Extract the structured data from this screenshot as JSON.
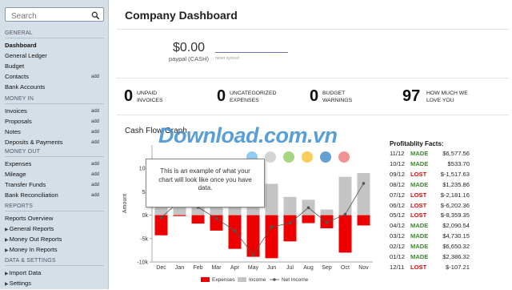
{
  "search": {
    "placeholder": "Search"
  },
  "sidebar": {
    "sections": [
      {
        "title": "General",
        "items": [
          {
            "label": "Dashboard",
            "active": true
          },
          {
            "label": "General Ledger"
          },
          {
            "label": "Budget"
          },
          {
            "label": "Contacts",
            "action": "add"
          },
          {
            "label": "Bank Accounts"
          }
        ]
      },
      {
        "title": "Money In",
        "items": [
          {
            "label": "Invoices",
            "action": "add"
          },
          {
            "label": "Proposals",
            "action": "add"
          },
          {
            "label": "Notes",
            "action": "add"
          },
          {
            "label": "Deposits & Payments",
            "action": "add"
          }
        ]
      },
      {
        "title": "Money Out",
        "items": [
          {
            "label": "Expenses",
            "action": "add"
          },
          {
            "label": "Mileage",
            "action": "add"
          },
          {
            "label": "Transfer Funds",
            "action": "add"
          },
          {
            "label": "Bank Reconciliation",
            "action": "add"
          }
        ]
      },
      {
        "title": "Reports",
        "items": [
          {
            "label": "Reports Overview"
          },
          {
            "label": "General Reports",
            "expandable": true
          },
          {
            "label": "Money Out Reports",
            "expandable": true
          },
          {
            "label": "Money In Reports",
            "expandable": true
          }
        ]
      },
      {
        "title": "Data & Settings",
        "items": [
          {
            "label": "Import Data",
            "expandable": true
          },
          {
            "label": "Settings",
            "expandable": true
          }
        ]
      }
    ]
  },
  "header": {
    "title": "Company Dashboard"
  },
  "balance": {
    "value": "$0.00",
    "label": "paypal (CASH)",
    "sync": "never synced"
  },
  "stats": [
    {
      "value": "0",
      "line1": "Unpaid",
      "line2": "Invoices"
    },
    {
      "value": "0",
      "line1": "Uncategorized",
      "line2": "Expenses"
    },
    {
      "value": "0",
      "line1": "Budget",
      "line2": "Warnings"
    },
    {
      "value": "97",
      "line1": "How much we",
      "line2": "love you"
    }
  ],
  "cashflow": {
    "title": "Cash Flow Graph",
    "watermark": "Download.com.vn",
    "tooltip": "This is an example of what your chart will look like once you have data.",
    "legend_colors": [
      "#7ec5ec",
      "#cccccc",
      "#9acd6a",
      "#f5c542",
      "#4a90c8",
      "#f08080"
    ]
  },
  "chart_data": {
    "type": "bar",
    "categories": [
      "Dec",
      "Jan",
      "Feb",
      "Mar",
      "Apr",
      "May",
      "Jun",
      "Jul",
      "Aug",
      "Sep",
      "Oct",
      "Nov"
    ],
    "ylabel": "Amount",
    "yticks": [
      "10k",
      "5k",
      "0k",
      "-5k",
      "-10k"
    ],
    "ylim": [
      -10000,
      15000
    ],
    "series": [
      {
        "name": "Expenses",
        "color": "#ee0000",
        "values": [
          -4300,
          -200,
          -1800,
          -3300,
          -7200,
          -8900,
          -9200,
          -5600,
          -1700,
          -2800,
          -8000,
          -2200
        ]
      },
      {
        "name": "Income",
        "color": "#c4c4c4",
        "values": [
          3800,
          3200,
          3500,
          2600,
          3900,
          4600,
          6700,
          3900,
          3300,
          1200,
          8200,
          9000
        ]
      },
      {
        "name": "Net Income",
        "color": "#555555",
        "values": [
          -500,
          3000,
          1700,
          -700,
          -3300,
          -8500,
          -2500,
          -1700,
          1600,
          -1600,
          200,
          6800
        ]
      }
    ]
  },
  "profitability": {
    "title": "Profitablity Facts:",
    "rows": [
      {
        "date": "11/12",
        "status": "MADE",
        "amount": "$6,577.56"
      },
      {
        "date": "10/12",
        "status": "MADE",
        "amount": "$533.70"
      },
      {
        "date": "09/12",
        "status": "LOST",
        "amount": "$-1,517.63"
      },
      {
        "date": "08/12",
        "status": "MADE",
        "amount": "$1,235.86"
      },
      {
        "date": "07/12",
        "status": "LOST",
        "amount": "$-2,181.16"
      },
      {
        "date": "06/12",
        "status": "LOST",
        "amount": "$-6,202.36"
      },
      {
        "date": "05/12",
        "status": "LOST",
        "amount": "$-8,359.35"
      },
      {
        "date": "04/12",
        "status": "MADE",
        "amount": "$2,090.54"
      },
      {
        "date": "03/12",
        "status": "MADE",
        "amount": "$4,730.15"
      },
      {
        "date": "02/12",
        "status": "MADE",
        "amount": "$6,650.32"
      },
      {
        "date": "01/12",
        "status": "MADE",
        "amount": "$2,386.32"
      },
      {
        "date": "12/11",
        "status": "LOST",
        "amount": "$-107.21"
      }
    ]
  }
}
